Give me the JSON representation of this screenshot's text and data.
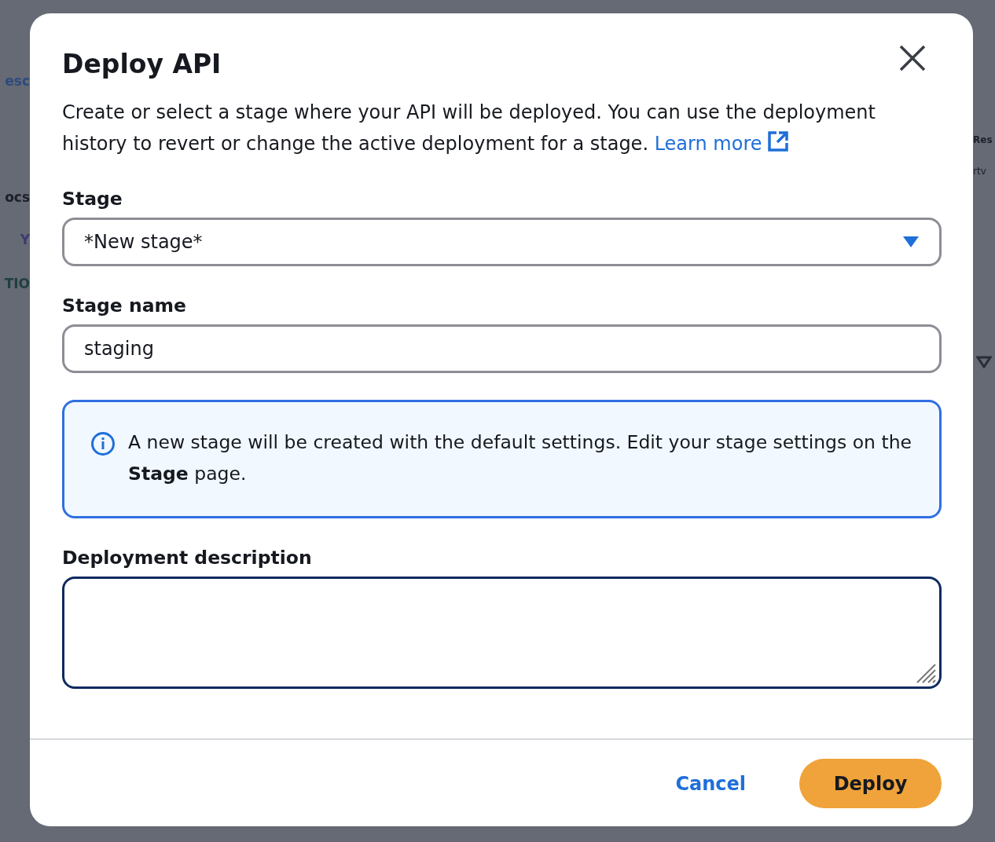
{
  "background": {
    "left_fragments": [
      "esc",
      "ocs",
      "Y",
      "TIO"
    ],
    "right_fragments": [
      "Res",
      "rtv"
    ]
  },
  "dialog": {
    "title": "Deploy API",
    "description": "Create or select a stage where your API will be deployed. You can use the deployment history to revert or change the active deployment for a stage.",
    "learn_more": "Learn more",
    "items": [
      {
        "kind": "select",
        "label": "Stage",
        "value": "*New stage*"
      },
      {
        "kind": "text",
        "label": "Stage name",
        "value": "staging"
      },
      {
        "kind": "info",
        "text": "A new stage will be created with the default settings. Edit your stage settings on the **Stage** page."
      },
      {
        "kind": "textarea",
        "label": "Deployment description"
      }
    ],
    "buttons": [
      {
        "kind": "link",
        "label": "Cancel"
      },
      {
        "kind": "primary",
        "label": "Deploy"
      }
    ]
  }
}
